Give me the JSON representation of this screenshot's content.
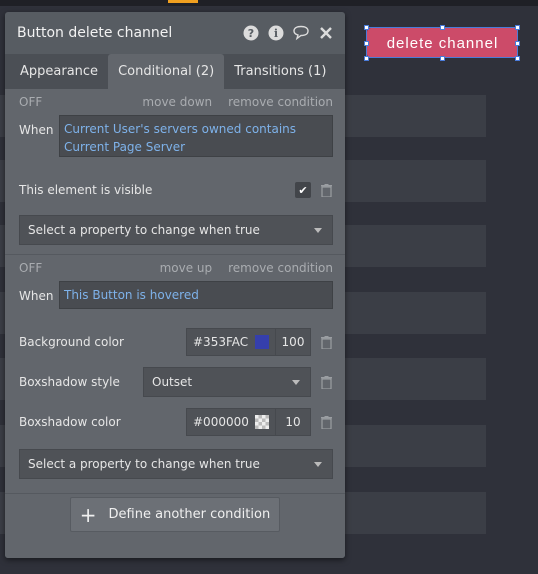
{
  "panel": {
    "title": "Button delete channel",
    "icons": [
      "help-icon",
      "info-icon",
      "comment-icon",
      "close-icon"
    ],
    "tabs": [
      {
        "label": "Appearance",
        "active": false
      },
      {
        "label": "Conditional (2)",
        "active": true
      },
      {
        "label": "Transitions (1)",
        "active": false
      }
    ]
  },
  "canvas": {
    "button_label": "delete channel",
    "button_color": "#cc4b69"
  },
  "conditions": [
    {
      "state": "OFF",
      "move_label": "move down",
      "remove_label": "remove condition",
      "when_label": "When",
      "expression": "Current User's servers owned contains Current Page Server",
      "properties": [
        {
          "label": "This element is visible",
          "checked": true
        }
      ],
      "select_placeholder": "Select a property to change when true"
    },
    {
      "state": "OFF",
      "move_label": "move up",
      "remove_label": "remove condition",
      "when_label": "When",
      "expression": "This Button is hovered",
      "properties": [
        {
          "label": "Background color",
          "value": "#353FAC",
          "swatch": "#353FAC",
          "opacity": "100"
        },
        {
          "label": "Boxshadow style",
          "value": "Outset"
        },
        {
          "label": "Boxshadow color",
          "value": "#000000",
          "swatch": "checker",
          "opacity": "10"
        }
      ],
      "select_placeholder": "Select a property to change when true"
    }
  ],
  "define_button": "Define another condition",
  "colors": {
    "panel_bg": "#575c62",
    "link": "#7eb2ea",
    "accent": "#cc4b69",
    "selection": "#4a7bd9"
  }
}
